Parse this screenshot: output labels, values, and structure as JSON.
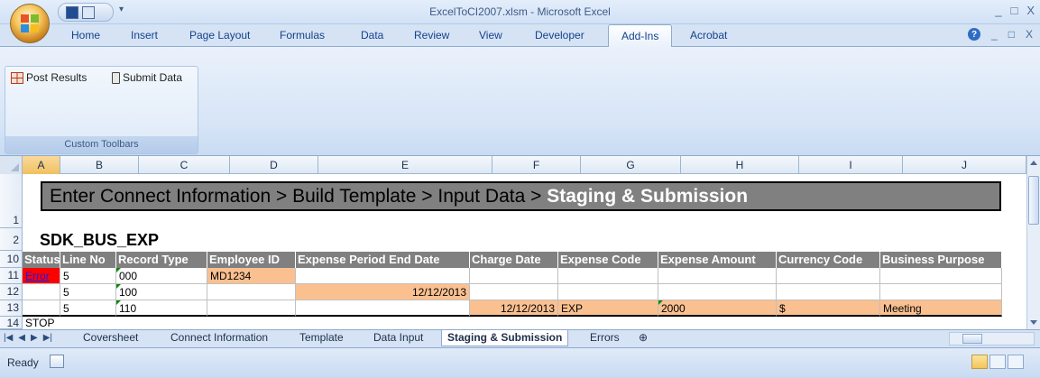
{
  "window": {
    "title": "ExcelToCI2007.xlsm - Microsoft Excel",
    "controls": [
      "_",
      "□",
      "X"
    ]
  },
  "ribbon_tabs": [
    "Home",
    "Insert",
    "Page Layout",
    "Formulas",
    "Data",
    "Review",
    "View",
    "Developer",
    "Add-Ins",
    "Acrobat"
  ],
  "active_tab": "Add-Ins",
  "ribbon_right": {
    "help": "?",
    "controls": [
      "_",
      "□",
      "X"
    ]
  },
  "group": {
    "post_label": "Post Results",
    "submit_label": "Submit Data",
    "group_label": "Custom Toolbars"
  },
  "columns": [
    "A",
    "B",
    "C",
    "D",
    "E",
    "F",
    "G",
    "H",
    "I",
    "J"
  ],
  "row_numbers": [
    "1",
    "2",
    "10",
    "11",
    "12",
    "13",
    "14"
  ],
  "banner": {
    "text": "Enter Connect Information > Build Template > Input Data > ",
    "highlight": "Staging & Submission"
  },
  "sheet_title": "SDK_BUS_EXP",
  "table": {
    "headers": [
      "Status",
      "Line No",
      "Record Type",
      "Employee ID",
      "Expense Period End Date",
      "Charge Date",
      "Expense Code",
      "Expense Amount",
      "Currency Code",
      "Business Purpose"
    ],
    "rows": [
      [
        "Error",
        "5",
        "000",
        "MD1234",
        "",
        "",
        "",
        "",
        "",
        ""
      ],
      [
        "",
        "5",
        "100",
        "",
        "12/12/2013",
        "",
        "",
        "",
        "",
        ""
      ],
      [
        "",
        "5",
        "110",
        "",
        "",
        "12/12/2013",
        "EXP",
        "2000",
        "$",
        "Meeting"
      ]
    ],
    "stop_label": "STOP"
  },
  "sheet_tabs": [
    "Coversheet",
    "Connect Information",
    "Template",
    "Data Input",
    "Staging & Submission",
    "Errors"
  ],
  "active_sheet": "Staging & Submission",
  "status": "Ready",
  "colors": {
    "peach": "#fac090",
    "header_gray": "#808080",
    "error_red": "#ff0000",
    "ribbon_blue": "#d5e3f5"
  }
}
